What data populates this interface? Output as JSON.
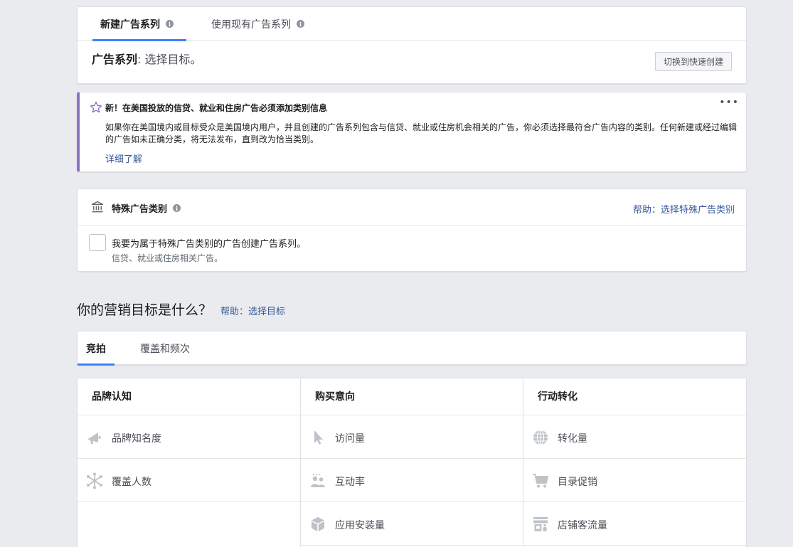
{
  "campaign_tabs": [
    {
      "label": "新建广告系列",
      "active": true
    },
    {
      "label": "使用现有广告系列",
      "active": false
    }
  ],
  "campaign_header": {
    "title": "广告系列",
    "separator": ":",
    "subtitle": "选择目标。",
    "quick_create_button": "切换到快速创建"
  },
  "notice": {
    "title": "新！在美国投放的信贷、就业和住房广告必须添加类别信息",
    "body": "如果你在美国境内或目标受众是美国境内用户，并且创建的广告系列包含与信贷、就业或住房机会相关的广告，你必须选择最符合广告内容的类别。任何新建或经过编辑的广告如未正确分类，将无法发布，直到改为恰当类别。",
    "link": "详细了解",
    "more": "•••",
    "accent_color": "#8b73c8"
  },
  "special_category": {
    "title": "特殊广告类别",
    "help_link": "帮助：选择特殊广告类别",
    "checkbox_label": "我要为属于特殊广告类别的广告创建广告系列。",
    "checkbox_sublabel": "信贷、就业或住房相关广告。",
    "checked": false
  },
  "objective_section": {
    "title": "你的营销目标是什么？",
    "help_link": "帮助：选择目标"
  },
  "buying_tabs": [
    {
      "label": "竞拍",
      "active": true
    },
    {
      "label": "覆盖和频次",
      "active": false
    }
  ],
  "objectives": {
    "columns": [
      {
        "header": "品牌认知",
        "items": [
          {
            "label": "品牌知名度",
            "icon": "megaphone-icon"
          },
          {
            "label": "覆盖人数",
            "icon": "reach-icon"
          }
        ]
      },
      {
        "header": "购买意向",
        "items": [
          {
            "label": "访问量",
            "icon": "cursor-icon"
          },
          {
            "label": "互动率",
            "icon": "people-icon"
          },
          {
            "label": "应用安装量",
            "icon": "box-icon"
          }
        ]
      },
      {
        "header": "行动转化",
        "items": [
          {
            "label": "转化量",
            "icon": "globe-icon"
          },
          {
            "label": "目录促销",
            "icon": "cart-icon"
          },
          {
            "label": "店铺客流量",
            "icon": "store-icon"
          }
        ]
      }
    ]
  },
  "colors": {
    "tab_underline": "#4080ff",
    "link": "#365899",
    "icon": "#bec3c9"
  }
}
